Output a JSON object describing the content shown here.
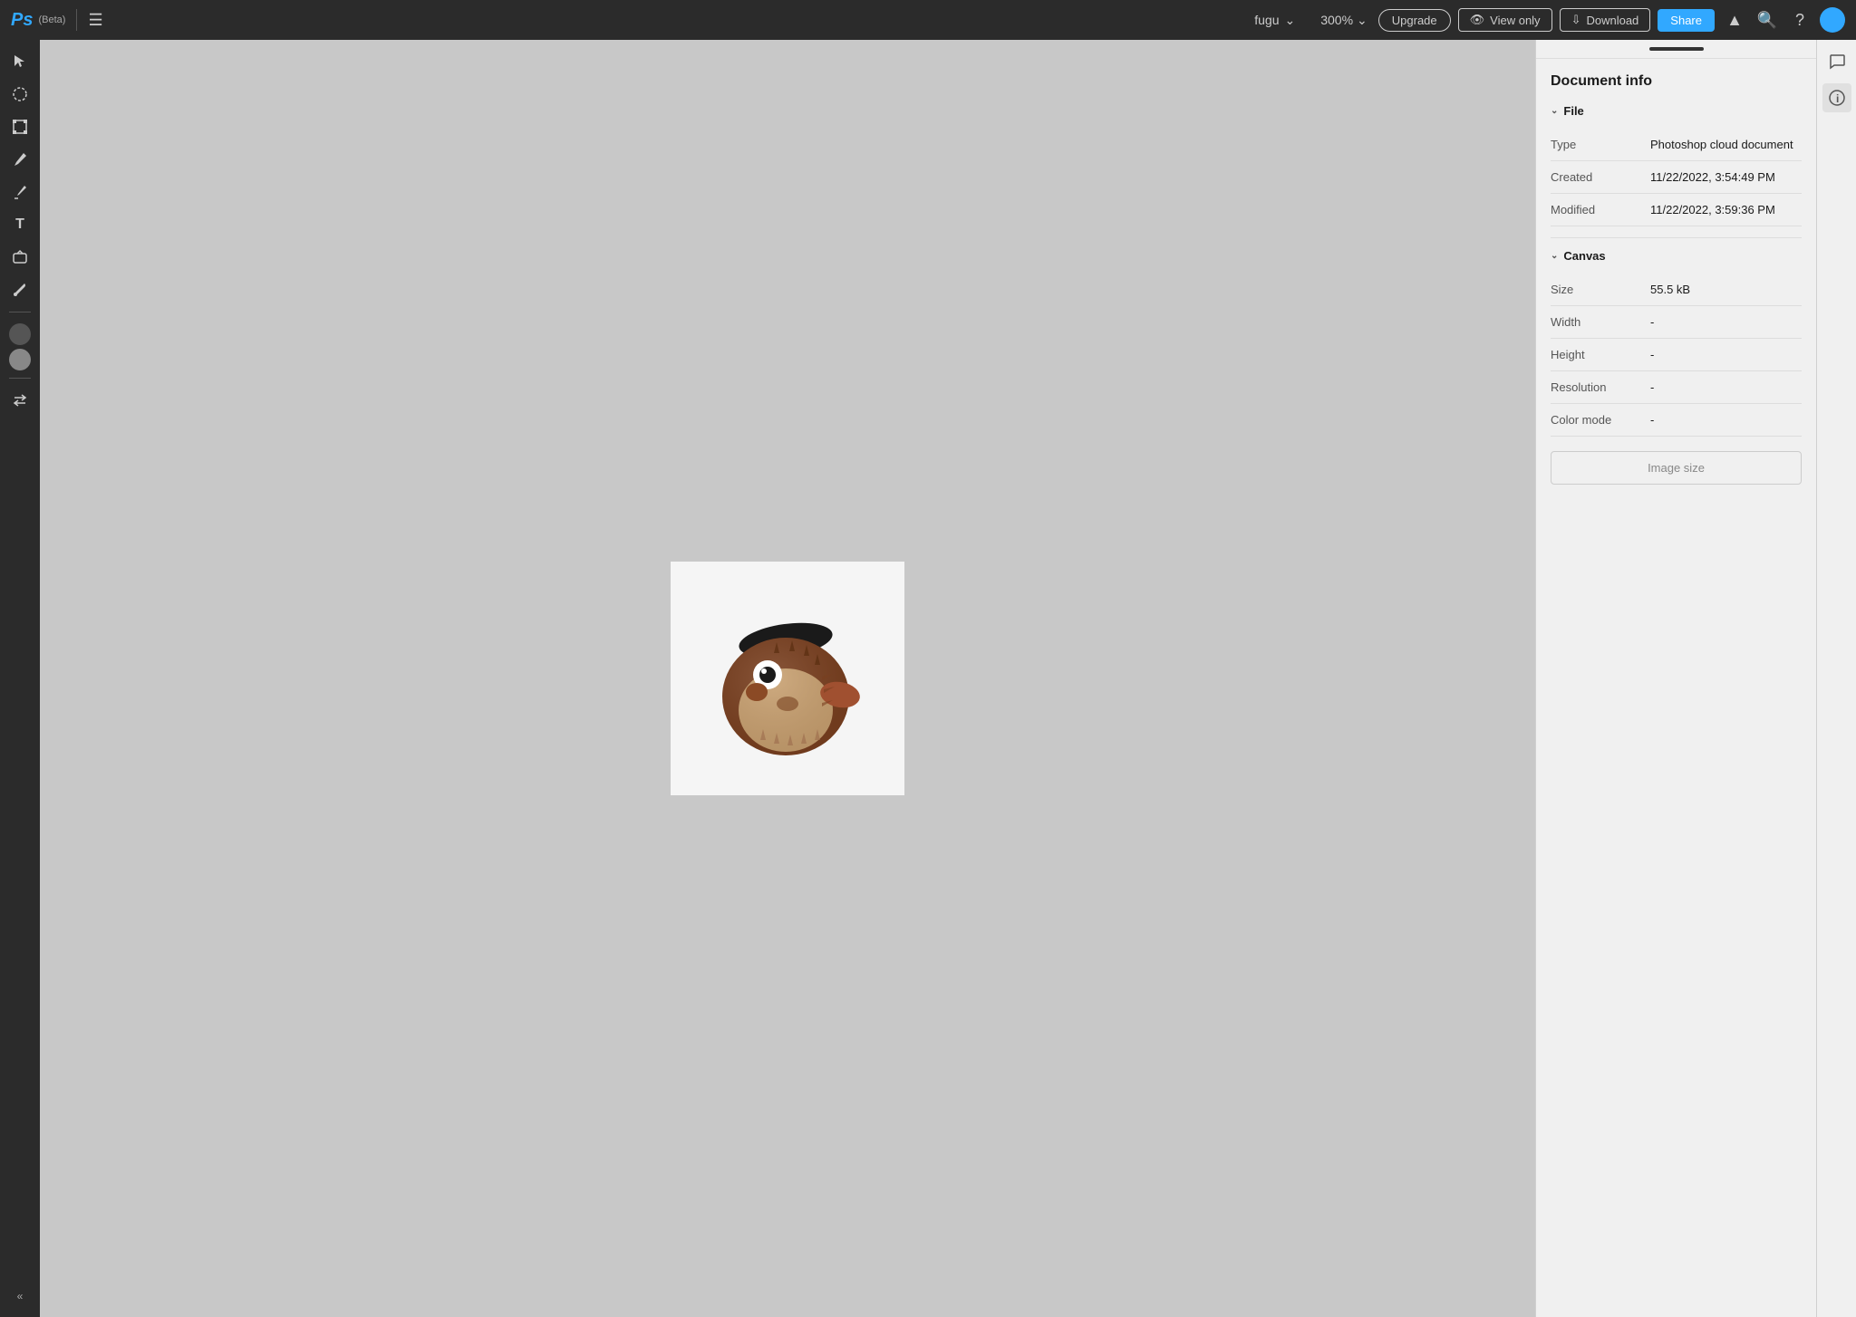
{
  "app": {
    "name": "Ps",
    "beta_label": "(Beta)"
  },
  "topbar": {
    "file_name": "fugu",
    "zoom": "300%",
    "upgrade_label": "Upgrade",
    "view_only_label": "View only",
    "download_label": "Download",
    "share_label": "Share"
  },
  "tools": [
    {
      "name": "select-tool",
      "icon": "↖",
      "label": "Select"
    },
    {
      "name": "circle-select-tool",
      "icon": "○",
      "label": "Ellipse select"
    },
    {
      "name": "transform-tool",
      "icon": "⊞",
      "label": "Transform"
    },
    {
      "name": "brush-tool",
      "icon": "✏",
      "label": "Brush"
    },
    {
      "name": "pen-tool",
      "icon": "✒",
      "label": "Pen"
    },
    {
      "name": "text-tool",
      "icon": "T",
      "label": "Text"
    },
    {
      "name": "shape-tool",
      "icon": "❖",
      "label": "Shape"
    },
    {
      "name": "eyedropper-tool",
      "icon": "⊘",
      "label": "Eyedropper"
    }
  ],
  "document_info": {
    "title": "Document info",
    "file_section": "File",
    "canvas_section": "Canvas",
    "fields": {
      "type_label": "Type",
      "type_value": "Photoshop cloud document",
      "created_label": "Created",
      "created_value": "11/22/2022, 3:54:49 PM",
      "modified_label": "Modified",
      "modified_value": "11/22/2022, 3:59:36 PM",
      "size_label": "Size",
      "size_value": "55.5 kB",
      "width_label": "Width",
      "width_value": "-",
      "height_label": "Height",
      "height_value": "-",
      "resolution_label": "Resolution",
      "resolution_value": "-",
      "color_mode_label": "Color mode",
      "color_mode_value": "-"
    },
    "image_size_button": "Image size"
  },
  "colors": {
    "accent_blue": "#31a8ff",
    "toolbar_bg": "#2b2b2b",
    "canvas_bg": "#c8c8c8",
    "panel_bg": "#f0f0f0"
  }
}
